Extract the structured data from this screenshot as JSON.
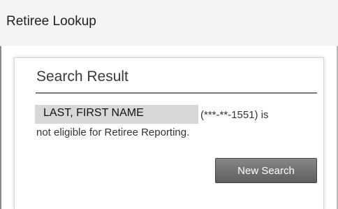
{
  "header": {
    "title": "Retiree Lookup"
  },
  "search_result": {
    "title": "Search Result",
    "name": "LAST, FIRST NAME",
    "ssn_suffix": "(***-**-1551) is",
    "message_line2": "not eligible for Retiree Reporting.",
    "new_search_label": "New Search"
  },
  "colors": {
    "header_bg": "#f4f4f4",
    "name_highlight": "#d7d7d7",
    "button_bg": "#6e6e6e",
    "button_text": "#ffffff"
  }
}
